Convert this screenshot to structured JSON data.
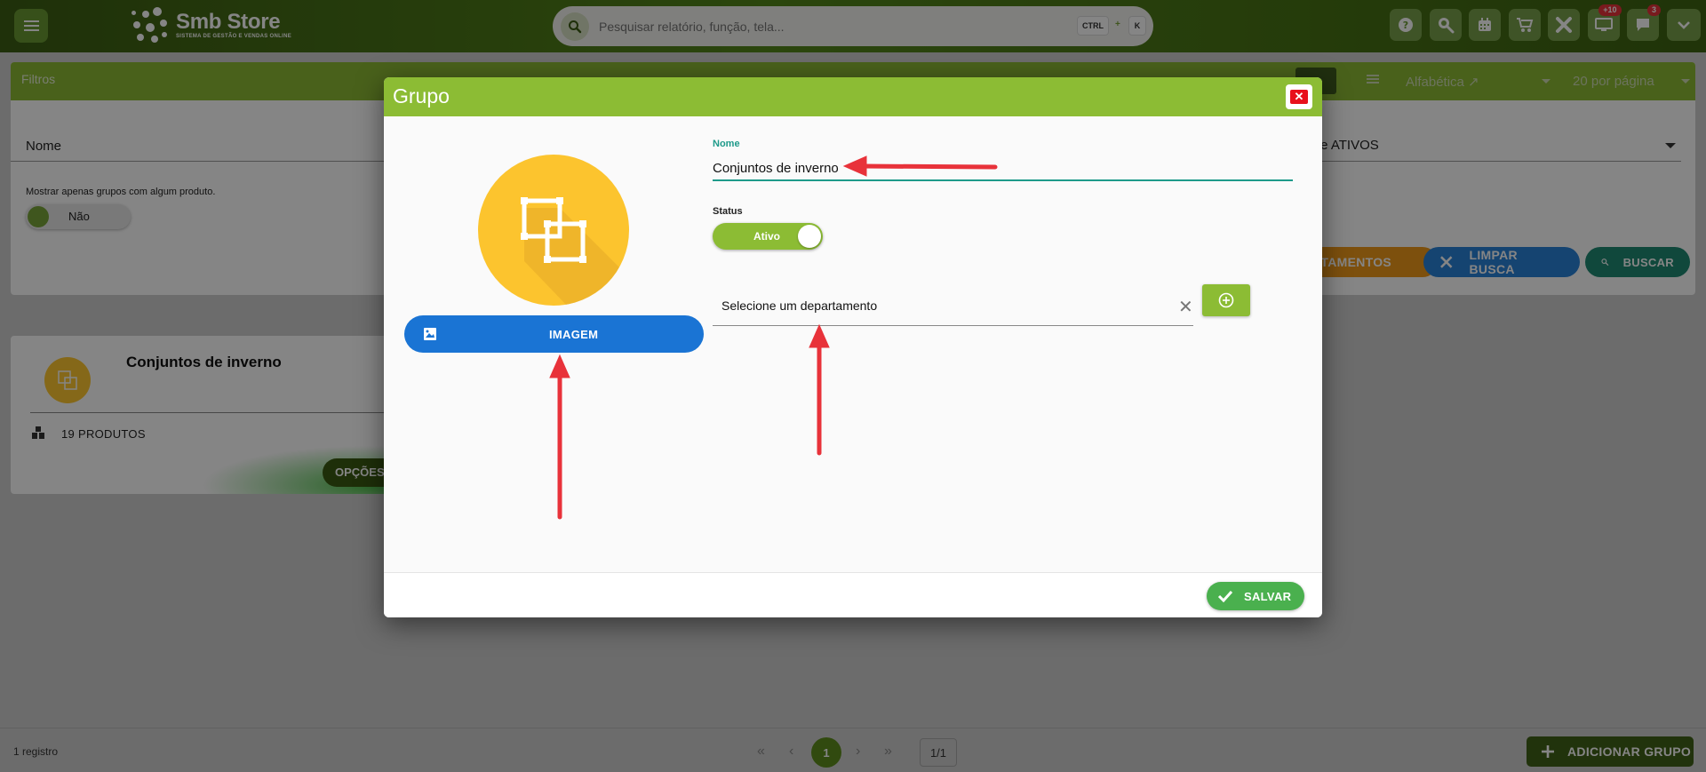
{
  "header": {
    "logo_title": "Smb Store",
    "logo_subtitle": "SISTEMA DE GESTÃO E VENDAS ONLINE",
    "search_placeholder": "Pesquisar relatório, função, tela...",
    "shortcut_ctrl": "CTRL",
    "shortcut_plus": "+",
    "shortcut_key": "K",
    "actions": [
      {
        "icon": "help-icon"
      },
      {
        "icon": "zoom-search-icon"
      },
      {
        "icon": "calendar-icon"
      },
      {
        "icon": "cart-icon"
      },
      {
        "icon": "tools-icon"
      },
      {
        "icon": "monitor-icon",
        "badge": "+10"
      },
      {
        "icon": "chat-icon",
        "badge": "3"
      },
      {
        "icon": "chevron-down-icon"
      }
    ]
  },
  "filters": {
    "title": "Filtros",
    "sort": "Alfabética ↗",
    "per_page": "20 por página",
    "nome_label": "Nome",
    "status_value": "te ATIVOS",
    "only_with_products_label": "Mostrar apenas grupos com algum produto.",
    "only_with_products_value": "Não",
    "btn_departamentos": "RTAMENTOS",
    "btn_limpar": "LIMPAR BUSCA",
    "btn_buscar": "BUSCAR"
  },
  "card": {
    "title": "Conjuntos de inverno",
    "products": "19 PRODUTOS",
    "options": "OPÇÕES"
  },
  "footer": {
    "records": "1 registro",
    "current_page": "1",
    "page_info": "1/1",
    "add_button": "ADICIONAR GRUPO"
  },
  "modal": {
    "title": "Grupo",
    "close": "✕",
    "image_button": "IMAGEM",
    "nome_label": "Nome",
    "nome_value": "Conjuntos de inverno",
    "status_label": "Status",
    "status_value": "Ativo",
    "departamento_placeholder": "Selecione um departamento",
    "save_button": "SALVAR"
  },
  "colors": {
    "brand_green": "#8cbc34",
    "accent_teal": "#1e9a8a",
    "button_blue": "#1a74d4",
    "save_green": "#4ab04e",
    "group_icon_yellow": "#fcc42e",
    "annotation_red": "#e8323a"
  }
}
